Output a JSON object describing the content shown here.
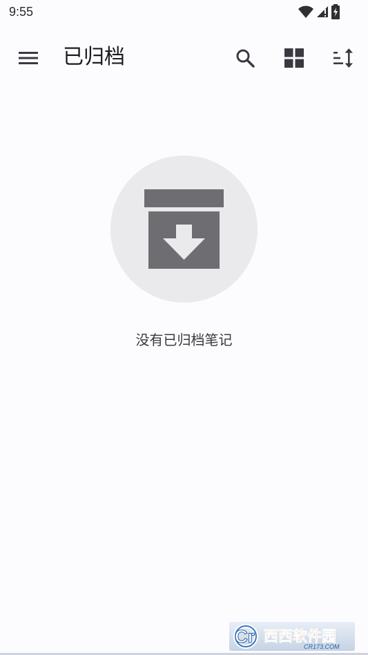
{
  "status_bar": {
    "time": "9:55"
  },
  "app_bar": {
    "title": "已归档",
    "menu_icon": "hamburger-menu-icon",
    "actions": [
      {
        "icon": "search-icon"
      },
      {
        "icon": "grid-view-icon"
      },
      {
        "icon": "sort-icon"
      }
    ]
  },
  "empty_state": {
    "icon": "archive-icon",
    "message": "没有已归档笔记"
  },
  "watermark": {
    "logo_text": "西西软件园",
    "sub_text": "CR173.COM"
  },
  "colors": {
    "background": "#fcfbfe",
    "icon_gray": "#6e6e72",
    "circle_bg": "#eaeaec",
    "text_dark": "#1d1b20"
  }
}
